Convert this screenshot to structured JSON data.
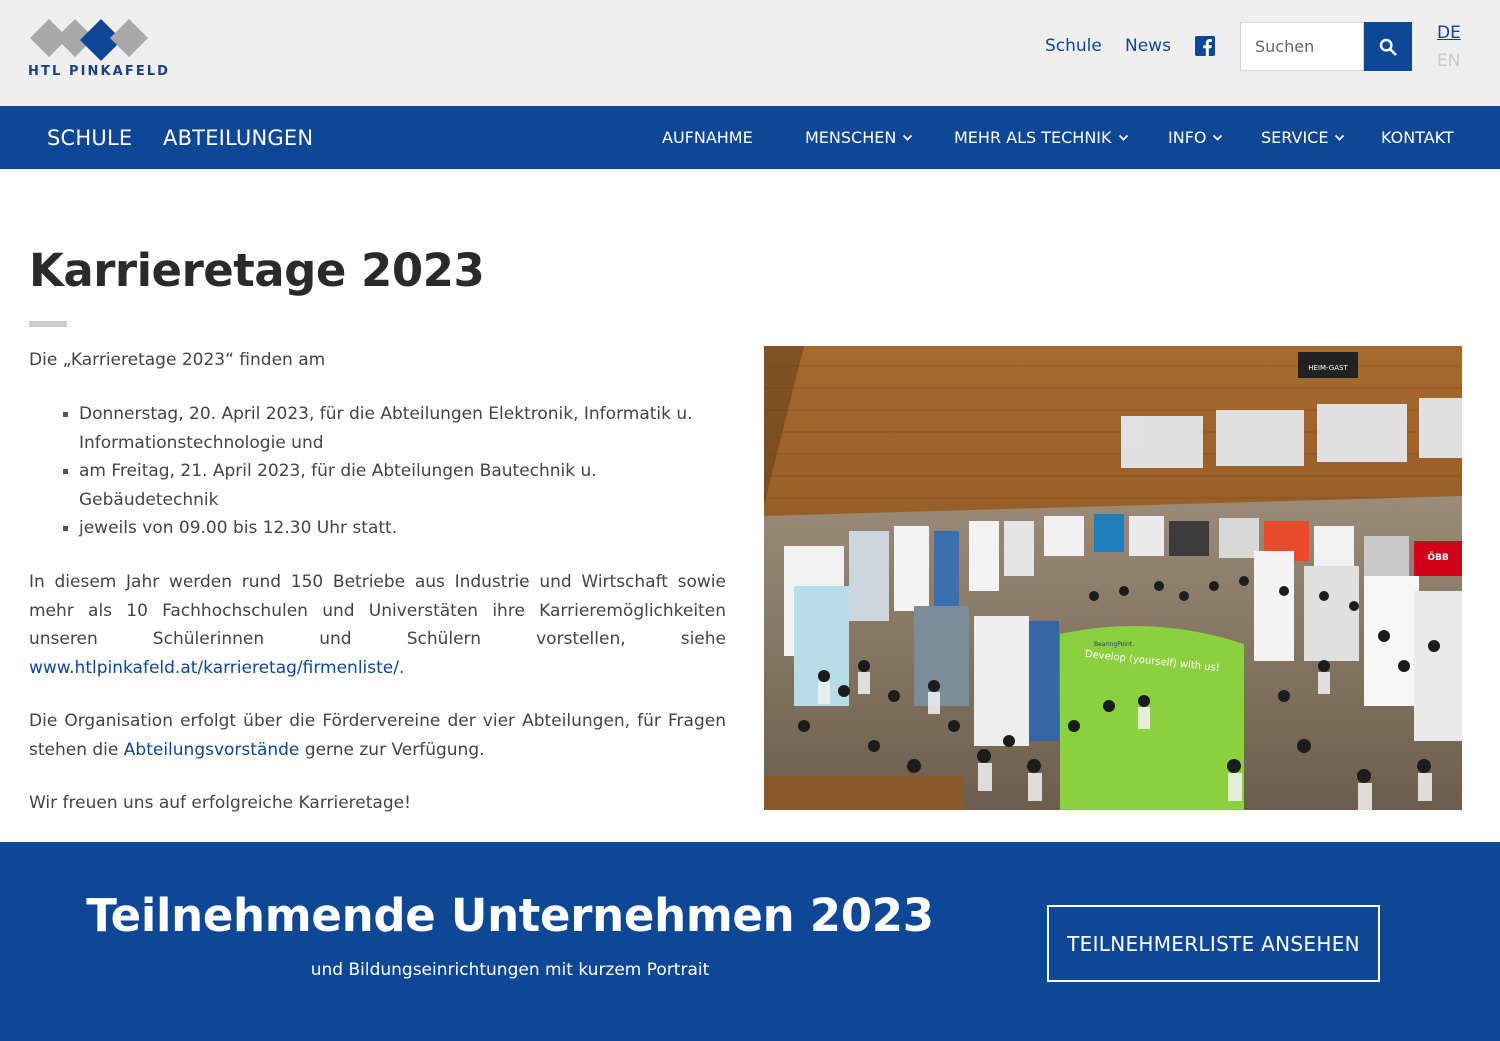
{
  "logo": {
    "text": "HTL PINKAFELD"
  },
  "header": {
    "links": [
      "Schule",
      "News"
    ],
    "facebook_icon": "facebook-icon",
    "search": {
      "placeholder": "Suchen",
      "icon": "search-icon"
    },
    "languages": {
      "de": "DE",
      "en": "EN"
    }
  },
  "nav": {
    "main": [
      "SCHULE",
      "ABTEILUNGEN"
    ],
    "items": [
      "AUFNAHME",
      "MENSCHEN",
      "MEHR ALS TECHNIK",
      "INFO",
      "SERVICE",
      "KONTAKT"
    ]
  },
  "content": {
    "title": "Karrieretage 2023",
    "intro": "Die „Karrieretage 2023“ finden am",
    "list": [
      "Donnerstag, 20. April 2023, für die Abteilungen Elektronik, Informatik u. Informationstechnologie und",
      "am Freitag, 21. April 2023, für die Abteilungen Bautechnik u. Gebäudetechnik",
      "jeweils von 09.00 bis 12.30 Uhr statt."
    ],
    "para1": "In diesem Jahr werden rund 150 Betriebe aus Industrie und Wirtschaft sowie mehr als 10 Fachhochschulen und Universtäten ihre Karrieremöglichkeiten unseren Schülerinnen und Schülern vorstellen, siehe ",
    "para1_link": "www.htlpinkafeld.at/karrieretag/firmenliste/",
    "para1_end": ".",
    "para2": "Die Organisation erfolgt über die Fördervereine der vier Abteilungen, für Fragen stehen die ",
    "para2_link": "Abteilungsvorstände",
    "para2_end": " gerne zur Verfügung.",
    "para3": "Wir freuen uns auf erfolgreiche Karrieretage!",
    "photo": {
      "booth_sign_1": "Develop (yourself) with us!",
      "booth_sign_2": "BearingPoint.",
      "banner_sign": "HEIM-GAST",
      "corner_sign": "ÖBB"
    }
  },
  "banner": {
    "title": "Teilnehmende Unternehmen 2023",
    "subtitle": "und Bildungseinrichtungen mit kurzem Portrait",
    "button": "TEILNEHMERLISTE ANSEHEN"
  },
  "colors": {
    "brand_blue": "#0d4796",
    "header_bg": "#efefef",
    "text": "#444444"
  }
}
